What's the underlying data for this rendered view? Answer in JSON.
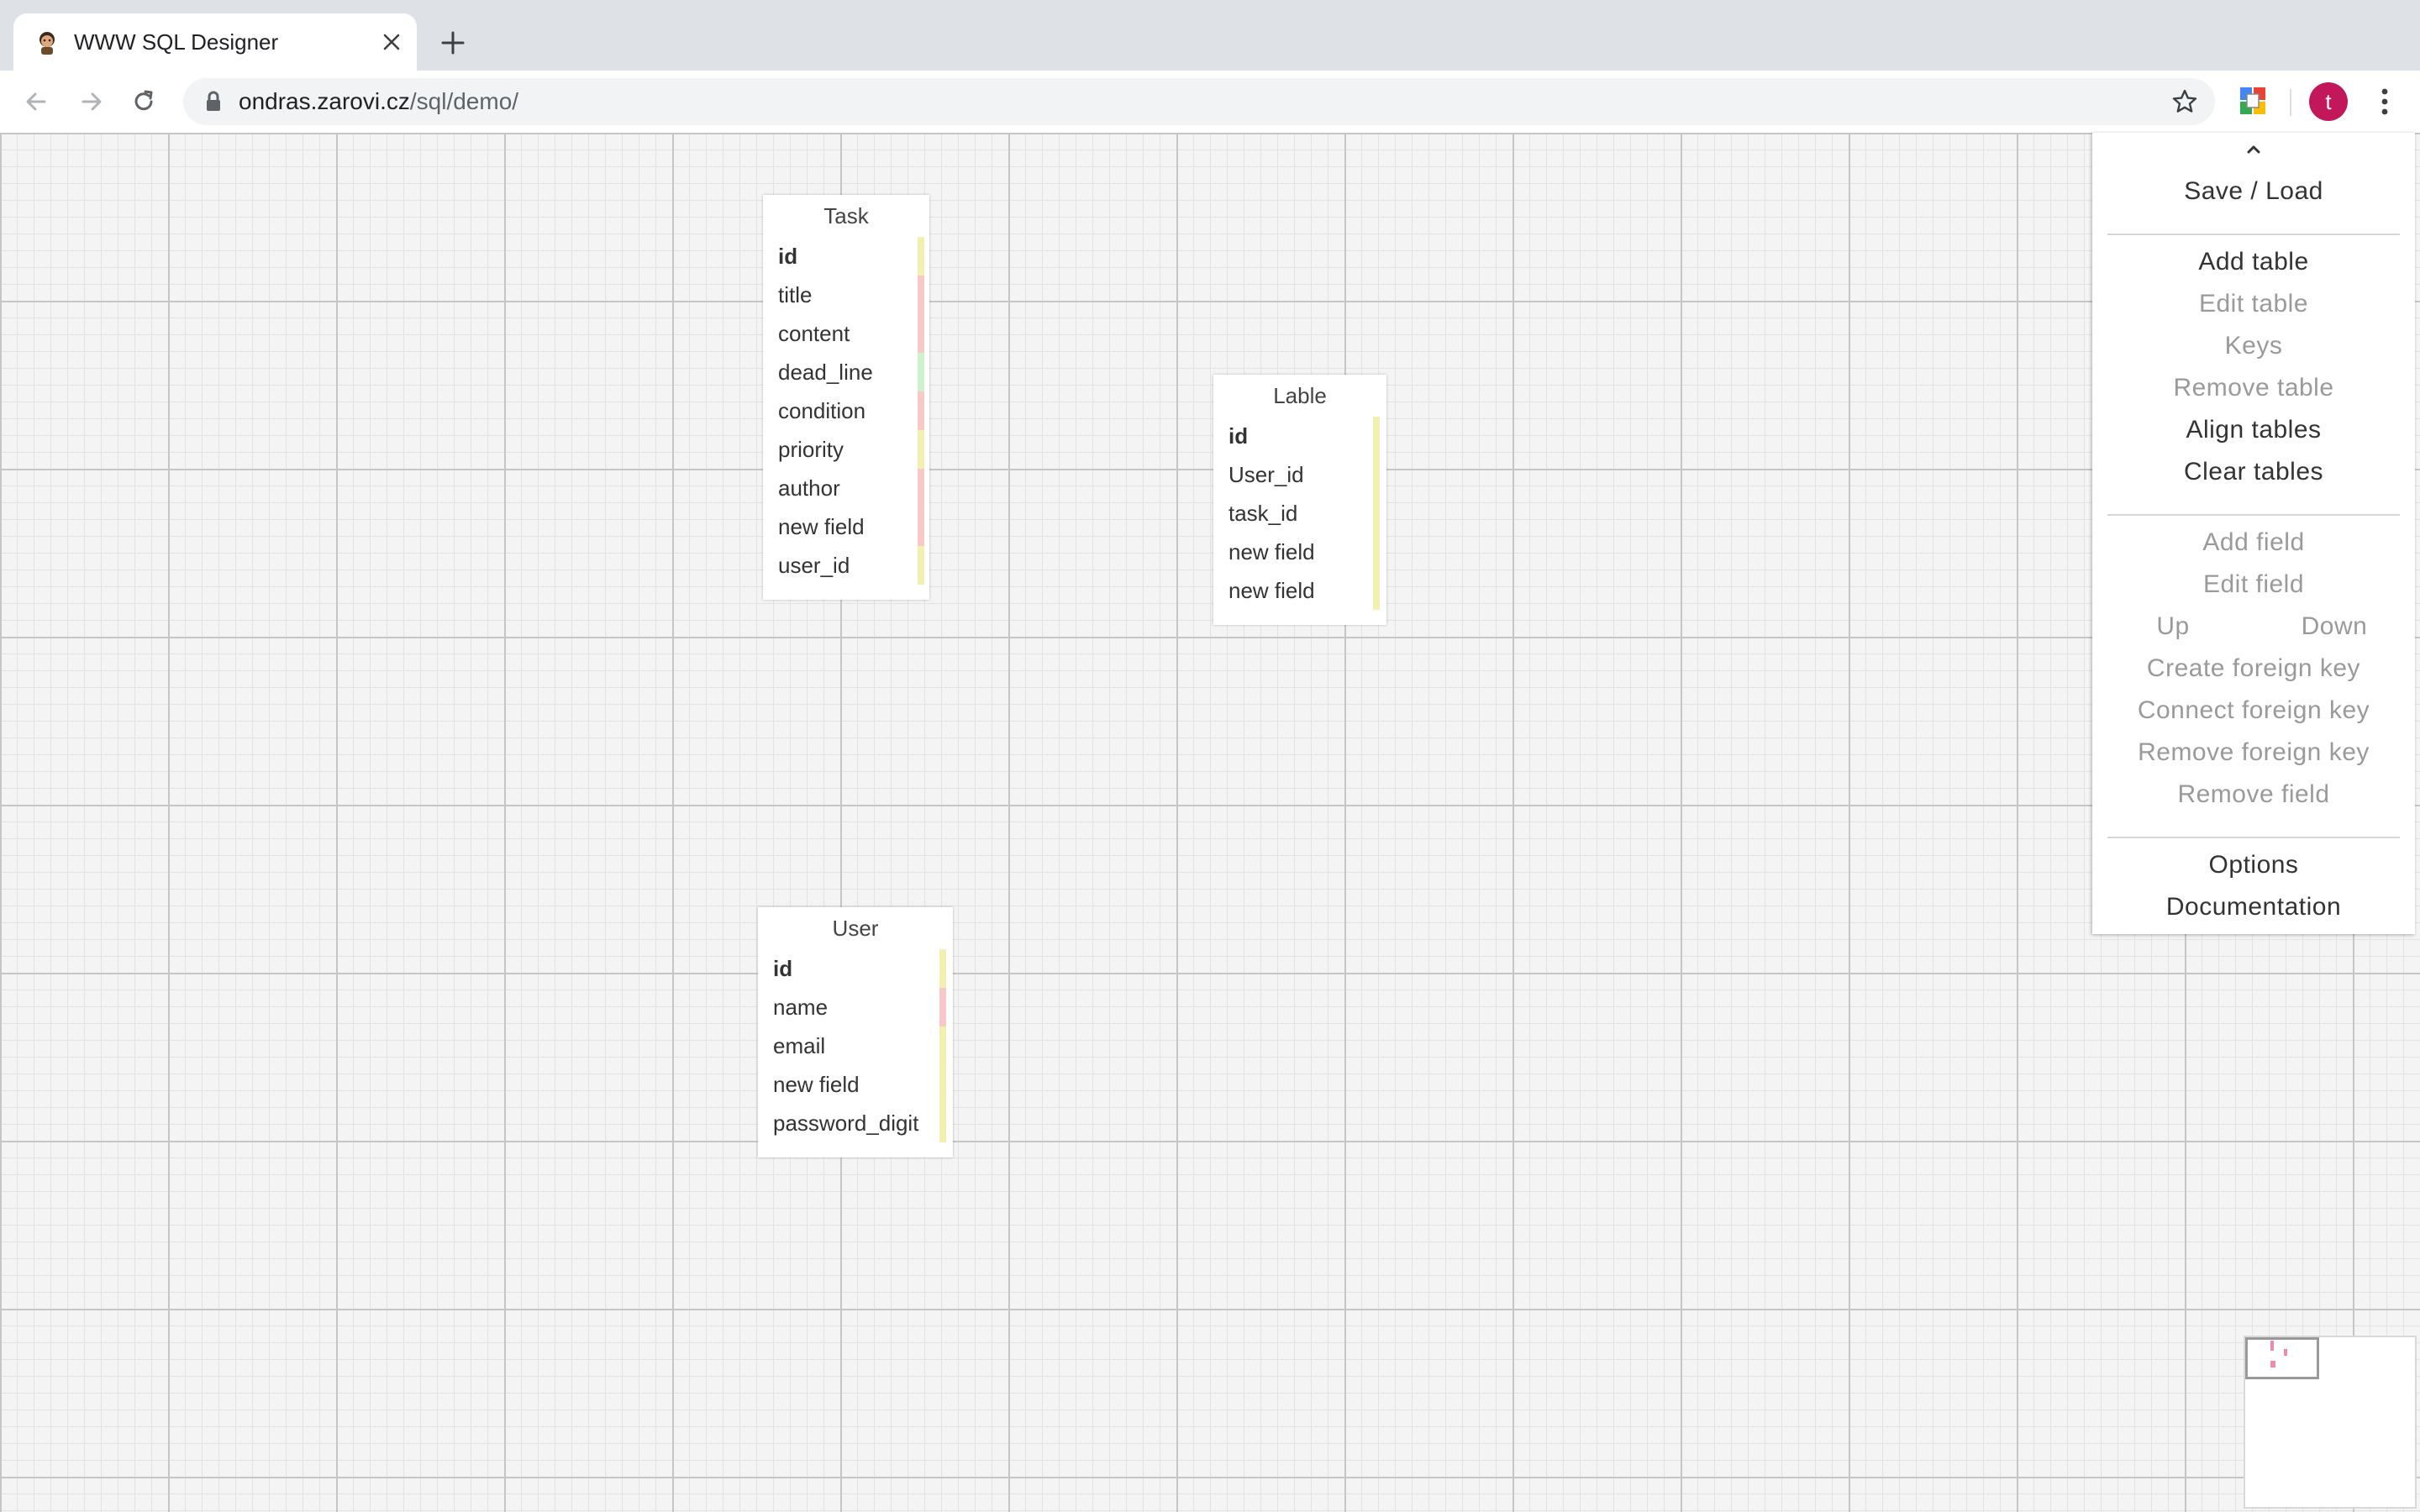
{
  "browser": {
    "tab_title": "WWW SQL Designer",
    "url_host": "ondras.zarovi.cz",
    "url_path": "/sql/demo/",
    "avatar_letter": "t",
    "avatar_color": "#c2185b"
  },
  "tables": {
    "task": {
      "name": "Task",
      "fields": [
        "id",
        "title",
        "content",
        "dead_line",
        "condition",
        "priority",
        "author",
        "new field",
        "user_id"
      ]
    },
    "lable": {
      "name": "Lable",
      "fields": [
        "id",
        "User_id",
        "task_id",
        "new field",
        "new field"
      ]
    },
    "user": {
      "name": "User",
      "fields": [
        "id",
        "name",
        "email",
        "new field",
        "password_digit"
      ]
    }
  },
  "field_colors": {
    "integer": "#f2f0b0",
    "text": "#f8c8c8",
    "date": "#cdf3cd"
  },
  "menu": {
    "save_load": "Save / Load",
    "add_table": "Add table",
    "edit_table": "Edit table",
    "keys": "Keys",
    "remove_table": "Remove table",
    "align_tables": "Align tables",
    "clear_tables": "Clear tables",
    "add_field": "Add field",
    "edit_field": "Edit field",
    "up": "Up",
    "down": "Down",
    "create_fk": "Create foreign key",
    "connect_fk": "Connect foreign key",
    "remove_fk": "Remove foreign key",
    "remove_field": "Remove field",
    "options": "Options",
    "documentation": "Documentation"
  }
}
